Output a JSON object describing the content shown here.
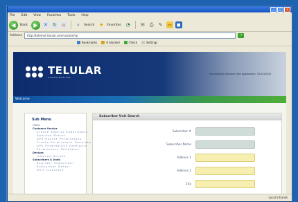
{
  "menubar": [
    "File",
    "Edit",
    "View",
    "Favorites",
    "Tools",
    "Help"
  ],
  "toolbar": {
    "back": "Back",
    "search": "Search",
    "favorites": "Favorites"
  },
  "address": {
    "label": "Address",
    "url": "http://telemat.telular.com/custom/cp"
  },
  "links": {
    "bookmarks": "Bookmarks",
    "blocked": "0 blocked",
    "check": "Check",
    "options": "Settings"
  },
  "header": {
    "brand": "TELULAR",
    "sub": "CORPORATION",
    "tagline": "Successfully Discover new Application. 10/12/2004"
  },
  "welcome": "Welcome",
  "sidebar": {
    "title": "Sub Menu",
    "items": [
      {
        "label": "Home",
        "kind": "item"
      },
      {
        "label": "Customer Service",
        "kind": "sec"
      },
      {
        "label": "Create Special Subscribers",
        "kind": "sub"
      },
      {
        "label": "Approve Status",
        "kind": "sub"
      },
      {
        "label": "GPS Routes Permissions",
        "kind": "sub"
      },
      {
        "label": "Create Permissions Template",
        "kind": "sub"
      },
      {
        "label": "GPS Permissions Configure",
        "kind": "sub"
      },
      {
        "label": "Permissions Templates",
        "kind": "sub"
      },
      {
        "label": "Devices",
        "kind": "sec"
      },
      {
        "label": "Inbound Access",
        "kind": "sub"
      },
      {
        "label": "Subscribers & Units",
        "kind": "sec"
      },
      {
        "label": "Register Subscriber",
        "kind": "sub"
      },
      {
        "label": "Subscriber Detail",
        "kind": "sub"
      },
      {
        "label": "Unit Inventory",
        "kind": "sub"
      }
    ]
  },
  "main": {
    "title": "Subscriber Unit Search",
    "fields": [
      {
        "label": "Subscriber #",
        "style": "gray"
      },
      {
        "label": "Subscriber Name",
        "style": "gray"
      },
      {
        "label": "Address 1",
        "style": "yellow"
      },
      {
        "label": "Address 2",
        "style": "yellow"
      },
      {
        "label": "City",
        "style": "yellow"
      }
    ]
  },
  "status": {
    "zone": "Local intranet"
  }
}
